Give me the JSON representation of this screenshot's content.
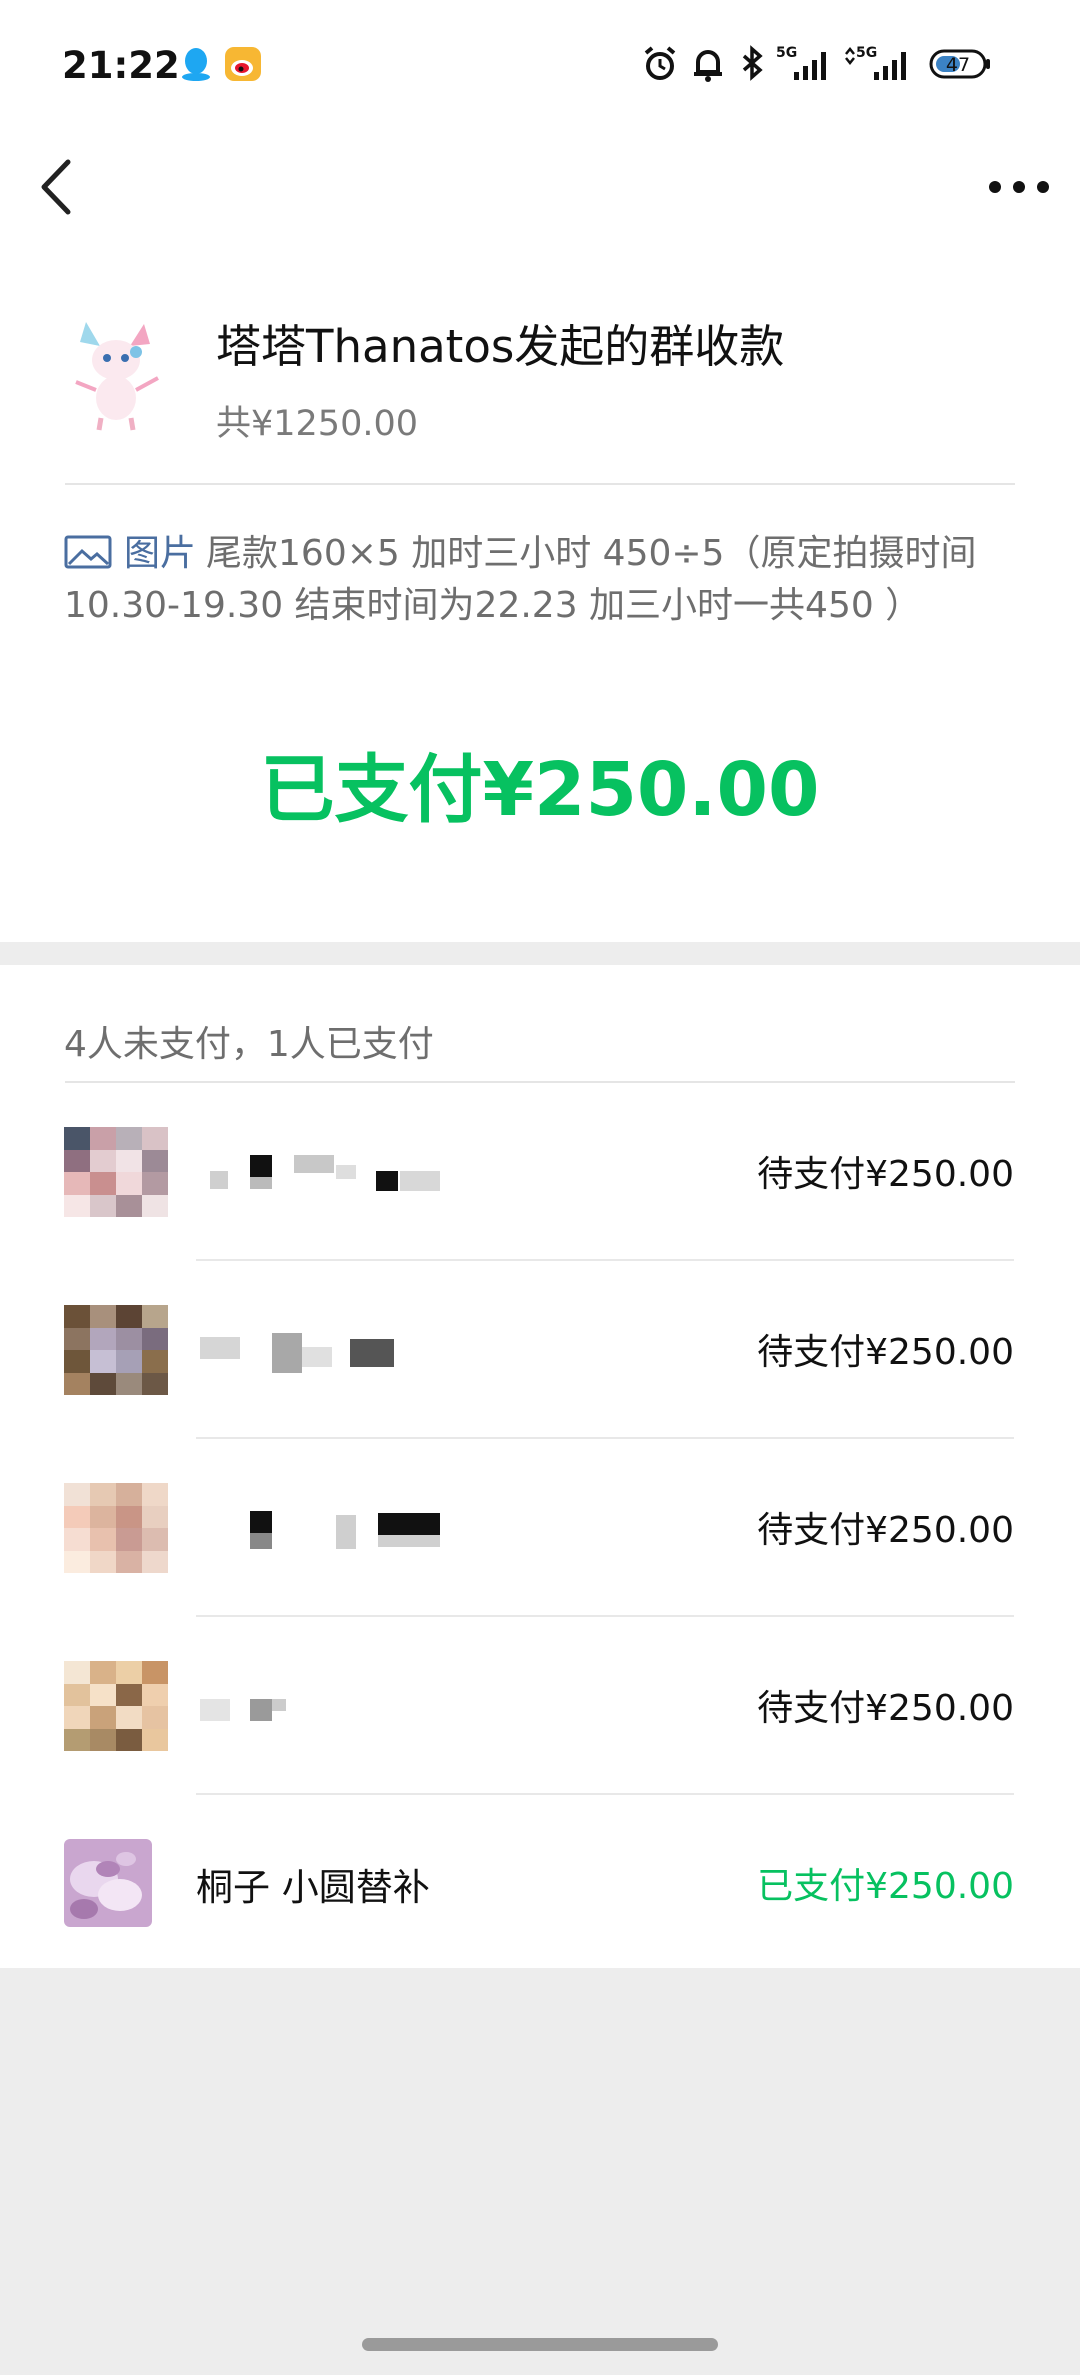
{
  "status_bar": {
    "time": "21:22",
    "battery": "47",
    "signal_1": "5G",
    "signal_2": "5G"
  },
  "nav": {
    "back_icon": "chevron-left-icon",
    "more_icon": "more-dots-icon"
  },
  "header": {
    "title": "塔塔Thanatos发起的群收款",
    "total": "共¥1250.00"
  },
  "note": {
    "image_label": "图片",
    "text": "尾款160×5 加时三小时 450÷5（原定拍摄时间10.30-19.30 结束时间为22.23 加三小时一共450 ）"
  },
  "paid_status": "已支付¥250.00",
  "members": {
    "summary": "4人未支付，1人已支付",
    "rows": [
      {
        "name": "",
        "amount": "待支付¥250.00",
        "paid": false
      },
      {
        "name": "",
        "amount": "待支付¥250.00",
        "paid": false
      },
      {
        "name": "",
        "amount": "待支付¥250.00",
        "paid": false
      },
      {
        "name": "",
        "amount": "待支付¥250.00",
        "paid": false
      },
      {
        "name": "桐子 小圆替补",
        "amount": "已支付¥250.00",
        "paid": true
      }
    ]
  },
  "colors": {
    "accent_green": "#07c160",
    "page_bg": "#ededed",
    "muted_text": "#6e6e6e",
    "link_blue": "#4a6ea0"
  }
}
